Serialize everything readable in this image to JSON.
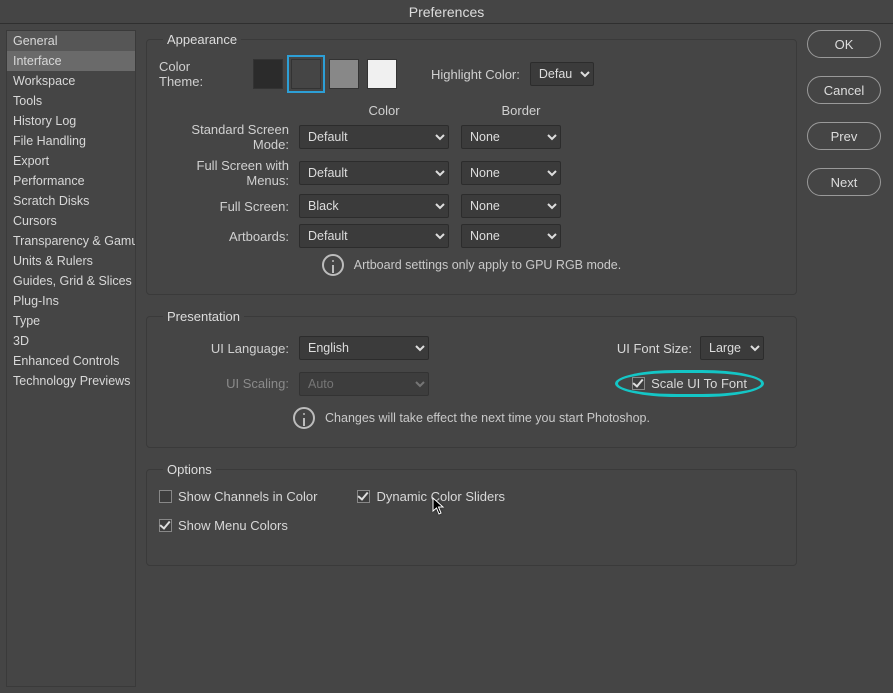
{
  "title": "Preferences",
  "sidebar": {
    "selected_index": 1,
    "items": [
      "General",
      "Interface",
      "Workspace",
      "Tools",
      "History Log",
      "File Handling",
      "Export",
      "Performance",
      "Scratch Disks",
      "Cursors",
      "Transparency & Gamut",
      "Units & Rulers",
      "Guides, Grid & Slices",
      "Plug-Ins",
      "Type",
      "3D",
      "Enhanced Controls",
      "Technology Previews"
    ]
  },
  "buttons": {
    "ok": "OK",
    "cancel": "Cancel",
    "prev": "Prev",
    "next": "Next"
  },
  "appearance": {
    "legend": "Appearance",
    "color_theme_label": "Color Theme:",
    "swatches": [
      "#2b2b2b",
      "#454545",
      "#888888",
      "#f0f0f0"
    ],
    "selected_swatch": 1,
    "highlight_label": "Highlight Color:",
    "highlight_value": "Default",
    "head_color": "Color",
    "head_border": "Border",
    "rows": [
      {
        "label": "Standard Screen Mode:",
        "color": "Default",
        "border": "None"
      },
      {
        "label": "Full Screen with Menus:",
        "color": "Default",
        "border": "None"
      },
      {
        "label": "Full Screen:",
        "color": "Black",
        "border": "None"
      },
      {
        "label": "Artboards:",
        "color": "Default",
        "border": "None"
      }
    ],
    "info": "Artboard settings only apply to GPU RGB mode."
  },
  "presentation": {
    "legend": "Presentation",
    "ui_language_label": "UI Language:",
    "ui_language_value": "English",
    "ui_scaling_label": "UI Scaling:",
    "ui_scaling_value": "Auto",
    "font_size_label": "UI Font Size:",
    "font_size_value": "Large",
    "scale_to_font_label": "Scale UI To Font",
    "scale_to_font_checked": true,
    "info": "Changes will take effect the next time you start Photoshop."
  },
  "options": {
    "legend": "Options",
    "show_channels": {
      "label": "Show Channels in Color",
      "checked": false
    },
    "dynamic_sliders": {
      "label": "Dynamic Color Sliders",
      "checked": true
    },
    "show_menu_colors": {
      "label": "Show Menu Colors",
      "checked": true
    }
  }
}
